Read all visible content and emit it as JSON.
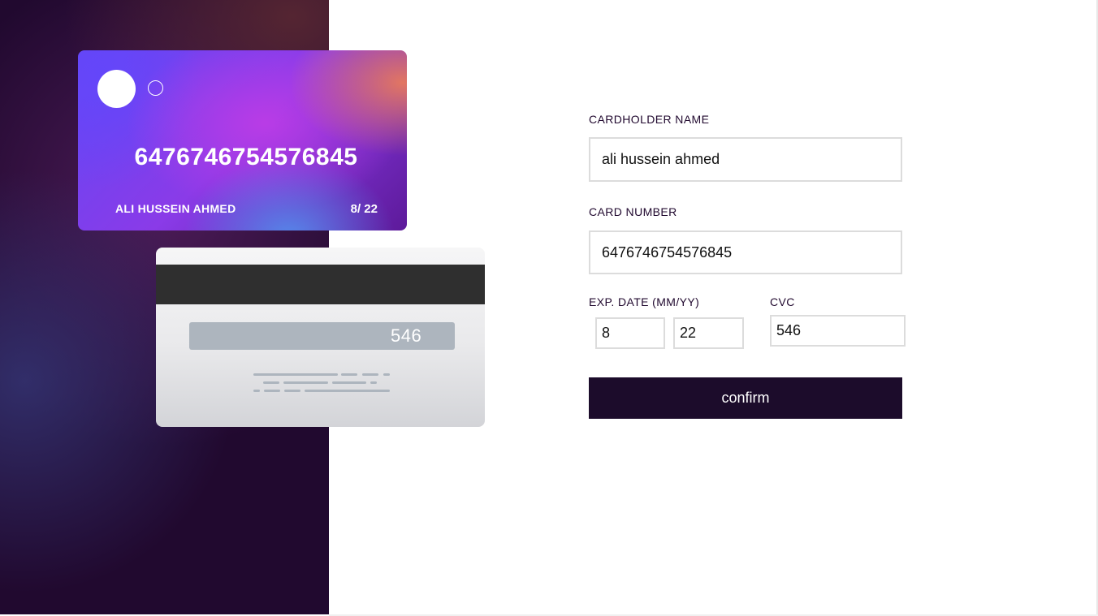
{
  "card_front": {
    "number": "6476746754576845",
    "name": "ALI HUSSEIN AHMED",
    "exp": "8/ 22"
  },
  "card_back": {
    "cvc": "546"
  },
  "form": {
    "name_label": "CARDHOLDER NAME",
    "name_value": "ali hussein ahmed",
    "number_label": "CARD NUMBER",
    "number_value": "6476746754576845",
    "exp_label": "EXP. DATE (MM/YY)",
    "exp_month_value": "8",
    "exp_year_value": "22",
    "cvc_label": "CVC",
    "cvc_value": "546",
    "confirm_label": "confirm"
  },
  "colors": {
    "dark_purple": "#21092f",
    "input_border": "#dcdcdc",
    "button_bg": "#1c0c2b"
  }
}
